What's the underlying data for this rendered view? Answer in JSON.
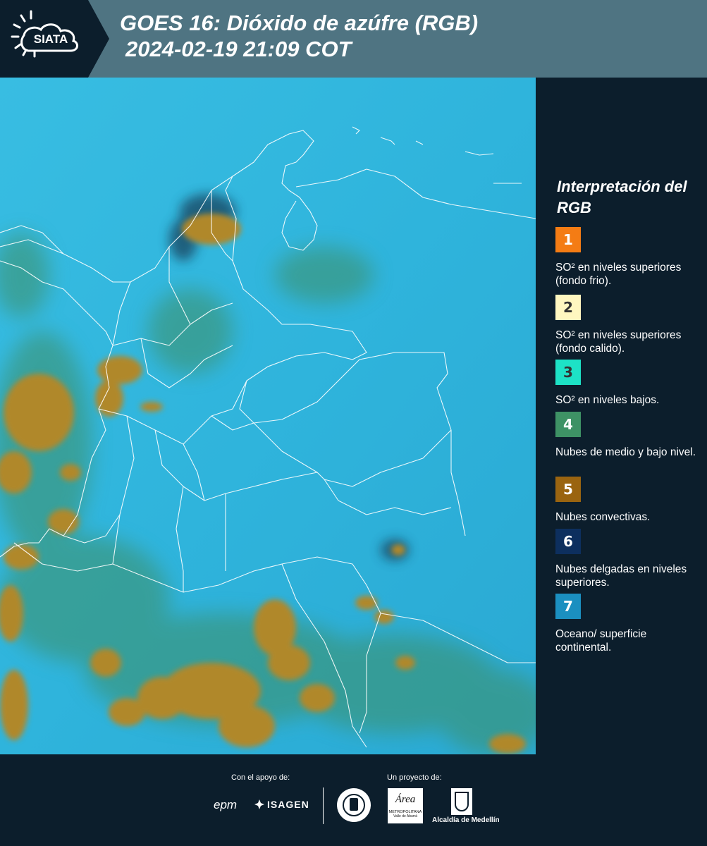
{
  "header": {
    "logo_text": "SIATA",
    "title_line1": "GOES 16: Dióxido de azúfre (RGB)",
    "title_line2": "2024-02-19 21:09 COT"
  },
  "legend": {
    "title": "Interpretación del RGB",
    "items": [
      {
        "number": "1",
        "color": "#f47c14",
        "text": "SO² en niveles superiores (fondo frio)."
      },
      {
        "number": "2",
        "color": "#fff7c0",
        "text": "SO² en niveles superiores (fondo calido)."
      },
      {
        "number": "3",
        "color": "#1de2c6",
        "text": "SO² en niveles bajos."
      },
      {
        "number": "4",
        "color": "#3e9265",
        "text": "Nubes de medio y bajo nivel."
      },
      {
        "number": "5",
        "color": "#9a6410",
        "text": "Nubes convectivas."
      },
      {
        "number": "6",
        "color": "#0d2f5e",
        "text": "Nubes delgadas en niveles superiores."
      },
      {
        "number": "7",
        "color": "#1b8fc0",
        "text": "Oceano/ superficie continental."
      }
    ]
  },
  "footer": {
    "support_label": "Con el apoyo de:",
    "project_label": "Un proyecto de:",
    "epm": "epm",
    "isagen": "ISAGEN",
    "area_name": "Área",
    "area_sub": "METROPOLITANA",
    "area_sub2": "Valle de Aburrá",
    "alcaldia": "Alcaldía de Medellín"
  },
  "colors": {
    "header_bg": "#4f7482",
    "logo_bg": "#0c1e2c",
    "panel_bg": "#0c1e2c",
    "ocean": "#2fb6dd",
    "cloud_convective": "#b08a2c",
    "cloud_low": "#3e9265"
  }
}
